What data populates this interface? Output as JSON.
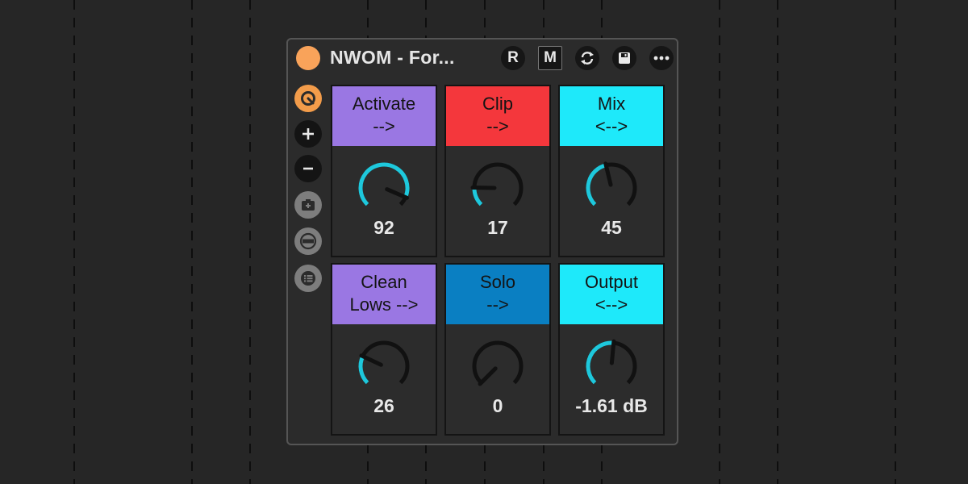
{
  "device": {
    "title": "NWOM - For...",
    "status_color": "#f9a35a"
  },
  "header_buttons": [
    {
      "name": "record-button",
      "label": "R"
    },
    {
      "name": "mode-button",
      "label": "M"
    },
    {
      "name": "sync-icon",
      "label": ""
    },
    {
      "name": "save-icon",
      "label": ""
    },
    {
      "name": "more-icon",
      "label": ""
    }
  ],
  "sidebar": {
    "items": [
      {
        "icon": "power-icon",
        "style": "orange"
      },
      {
        "icon": "plus-icon",
        "style": "dark"
      },
      {
        "icon": "minus-icon",
        "style": "dark"
      },
      {
        "icon": "camera-add-icon",
        "style": "grey"
      },
      {
        "icon": "dash-icon",
        "style": "grey"
      },
      {
        "icon": "list-icon",
        "style": "grey"
      }
    ]
  },
  "controls": [
    {
      "line1": "Activate",
      "line2": "-->",
      "value": "92",
      "fraction": 0.92,
      "color": "#9a77e3"
    },
    {
      "line1": "Clip",
      "line2": "-->",
      "value": "17",
      "fraction": 0.17,
      "color": "#f4373c"
    },
    {
      "line1": "Mix",
      "line2": "<-->",
      "value": "45",
      "fraction": 0.45,
      "color": "#1ee9fa"
    },
    {
      "line1": "Clean",
      "line2": "Lows -->",
      "value": "26",
      "fraction": 0.26,
      "color": "#9a77e3"
    },
    {
      "line1": "Solo",
      "line2": "-->",
      "value": "0",
      "fraction": 0.0,
      "color": "#0a7fc2"
    },
    {
      "line1": "Output",
      "line2": "<-->",
      "value": "-1.61 dB",
      "fraction": 0.52,
      "color": "#1ee9fa"
    }
  ],
  "colors": {
    "knob_track": "#111111",
    "knob_fill": "#1ec8dc",
    "background": "#262626"
  }
}
